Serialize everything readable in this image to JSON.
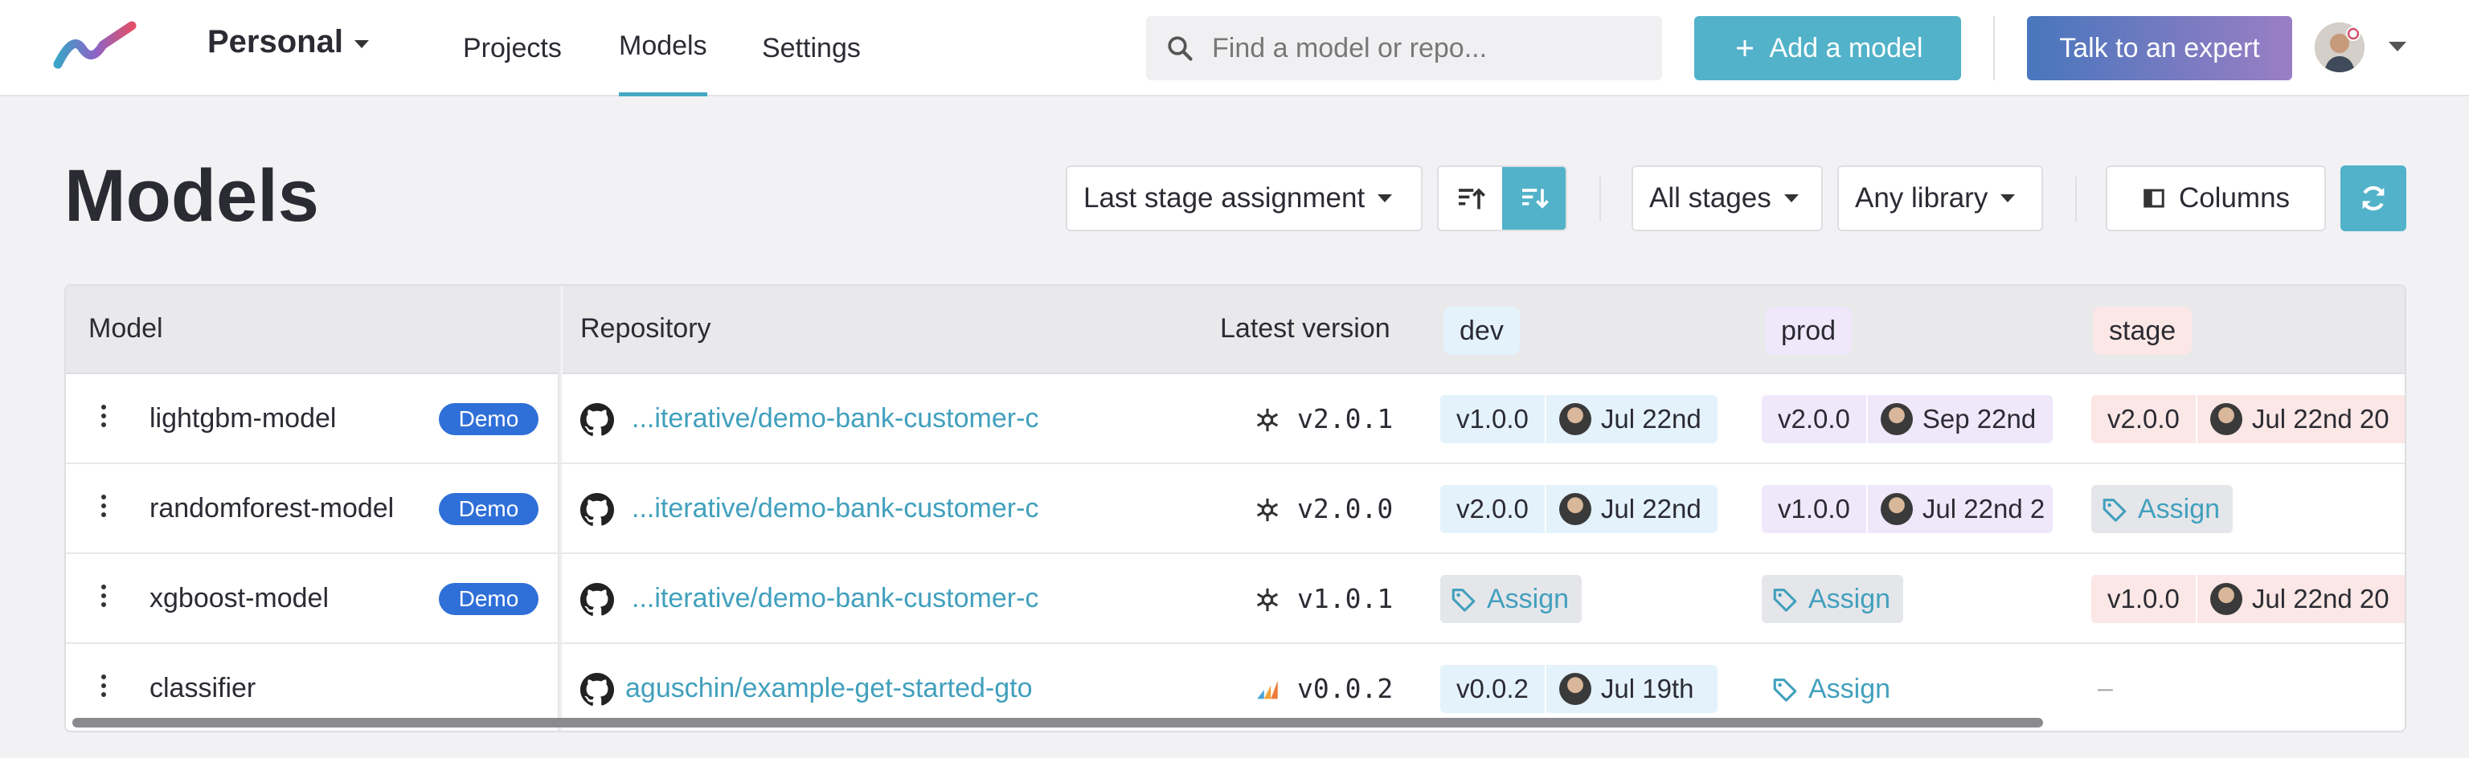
{
  "header": {
    "workspace": "Personal",
    "nav": [
      {
        "label": "Projects",
        "active": false
      },
      {
        "label": "Models",
        "active": true
      },
      {
        "label": "Settings",
        "active": false
      }
    ],
    "search_placeholder": "Find a model or repo...",
    "add_model_label": "Add a model",
    "expert_label": "Talk to an expert",
    "accent": "#52b2c9"
  },
  "page": {
    "title": "Models",
    "sort_select": "Last stage assignment",
    "stages_filter": "All stages",
    "library_filter": "Any library",
    "columns_label": "Columns"
  },
  "table": {
    "headers": {
      "model": "Model",
      "repository": "Repository",
      "latest_version": "Latest version",
      "stage_dev": "dev",
      "stage_prod": "prod",
      "stage_stage": "stage"
    },
    "stage_colors": {
      "dev": "#e4f2fb",
      "prod": "#efe8fb",
      "stage": "#fbe7e5"
    },
    "rows": [
      {
        "name": "lightgbm-model",
        "badge": "Demo",
        "repo": "...iterative/demo-bank-customer-c",
        "version": "v2.0.1",
        "dev_version": "v1.0.0",
        "dev_date": "Jul 22nd",
        "prod_version": "v2.0.0",
        "prod_date": "Sep 22nd",
        "stage_version": "v2.0.0",
        "stage_date": "Jul 22nd 20"
      },
      {
        "name": "randomforest-model",
        "badge": "Demo",
        "repo": "...iterative/demo-bank-customer-c",
        "version": "v2.0.0",
        "dev_version": "v2.0.0",
        "dev_date": "Jul 22nd",
        "prod_version": "v1.0.0",
        "prod_date": "Jul 22nd 2",
        "stage_assign": "Assign"
      },
      {
        "name": "xgboost-model",
        "badge": "Demo",
        "repo": "...iterative/demo-bank-customer-c",
        "version": "v1.0.1",
        "dev_assign": "Assign",
        "prod_assign": "Assign",
        "stage_version": "v1.0.0",
        "stage_date": "Jul 22nd 20"
      },
      {
        "name": "classifier",
        "repo": "aguschin/example-get-started-gto",
        "version": "v0.0.2",
        "dev_version": "v0.0.2",
        "dev_date": "Jul 19th",
        "prod_assign": "Assign",
        "stage_empty": "–"
      }
    ]
  }
}
